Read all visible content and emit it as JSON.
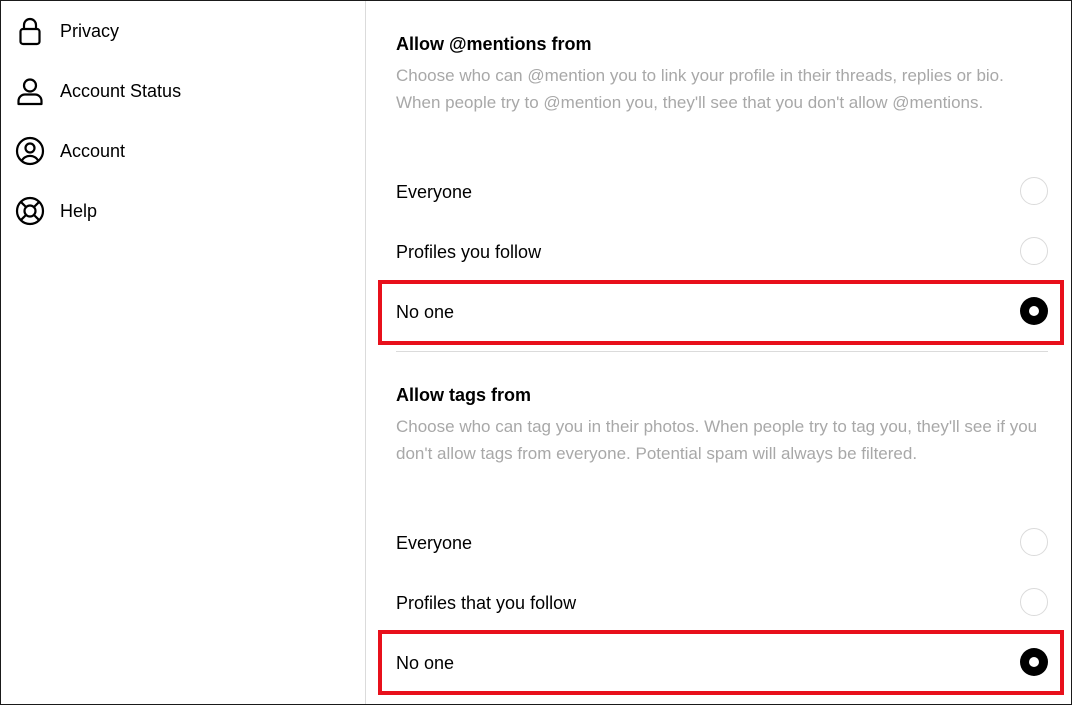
{
  "sidebar": {
    "items": [
      {
        "label": "Privacy",
        "icon": "lock-icon"
      },
      {
        "label": "Account Status",
        "icon": "person-icon"
      },
      {
        "label": "Account",
        "icon": "account-circle-icon"
      },
      {
        "label": "Help",
        "icon": "lifebuoy-icon"
      }
    ]
  },
  "mentions": {
    "title": "Allow @mentions from",
    "description": "Choose who can @mention you to link your profile in their threads, replies or bio. When people try to @mention you, they'll see that you don't allow @mentions.",
    "options": [
      {
        "label": "Everyone",
        "selected": false
      },
      {
        "label": "Profiles you follow",
        "selected": false
      },
      {
        "label": "No one",
        "selected": true
      }
    ]
  },
  "tags": {
    "title": "Allow tags from",
    "description": "Choose who can tag you in their photos. When people try to tag you, they'll see if you don't allow tags from everyone. Potential spam will always be filtered.",
    "options": [
      {
        "label": "Everyone",
        "selected": false
      },
      {
        "label": "Profiles that you follow",
        "selected": false
      },
      {
        "label": "No one",
        "selected": true
      }
    ]
  },
  "colors": {
    "highlight": "#e8101b",
    "secondary_text": "#a8a8a8",
    "divider": "#dbdbdb"
  }
}
